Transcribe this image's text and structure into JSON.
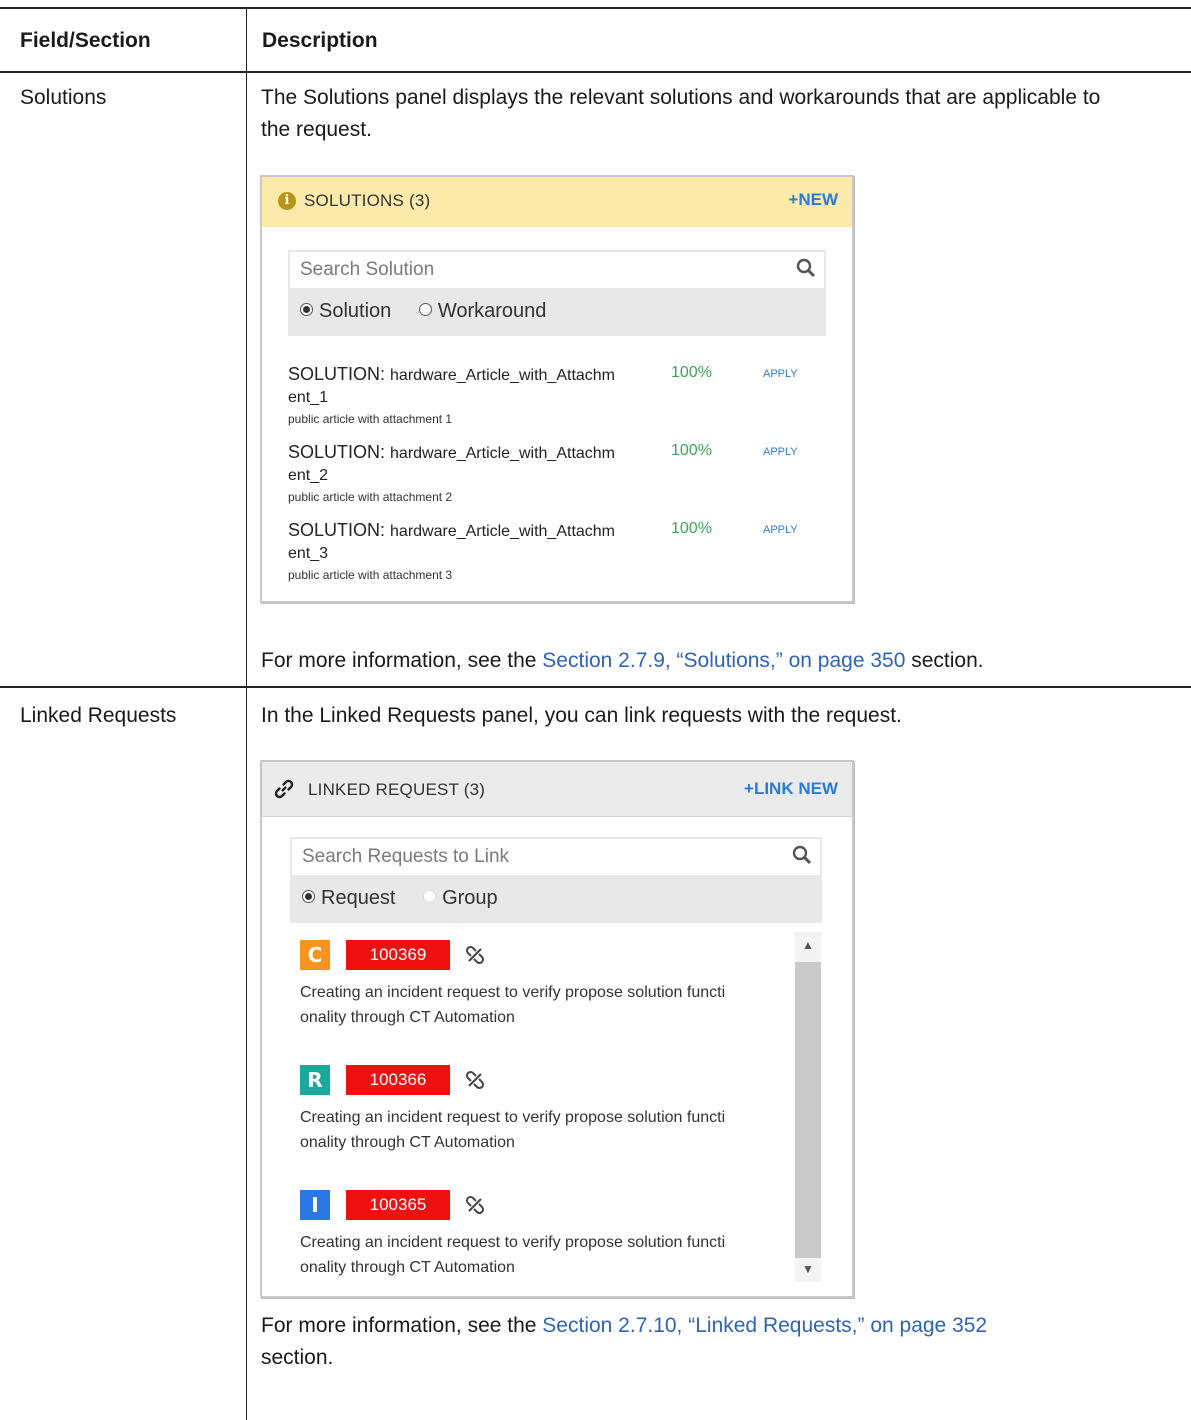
{
  "table": {
    "col1_header": "Field/Section",
    "col2_header": "Description"
  },
  "solutions_row": {
    "field": "Solutions",
    "description": "The Solutions panel displays the relevant solutions and workarounds that are applicable to the request.",
    "more_prefix": "For more information, see the ",
    "more_link": "Section 2.7.9, “Solutions,” on page 350",
    "more_suffix": " section.",
    "panel": {
      "title": "SOLUTIONS (3)",
      "action": "+NEW",
      "search_placeholder": "Search Solution",
      "radio_1": "Solution",
      "radio_2": "Workaround",
      "items": [
        {
          "prefix": "SOLUTION: ",
          "name": "hardware_Article_with_Attachm",
          "name_cont": "ent_1",
          "sub": "public article with attachment 1",
          "pct": "100%",
          "apply": "APPLY"
        },
        {
          "prefix": "SOLUTION: ",
          "name": "hardware_Article_with_Attachm",
          "name_cont": "ent_2",
          "sub": "public article with attachment 2",
          "pct": "100%",
          "apply": "APPLY"
        },
        {
          "prefix": "SOLUTION: ",
          "name": "hardware_Article_with_Attachm",
          "name_cont": "ent_3",
          "sub": "public article with attachment 3",
          "pct": "100%",
          "apply": "APPLY"
        }
      ]
    }
  },
  "linked_row": {
    "field": "Linked Requests",
    "description": "In the Linked Requests panel, you can link requests with the request.",
    "more_prefix": "For more information, see the ",
    "more_link": "Section 2.7.10, “Linked Requests,” on page 352",
    "more_suffix": "section.",
    "panel": {
      "title": "LINKED REQUEST (3)",
      "action": "+LINK NEW",
      "search_placeholder": "Search Requests to Link",
      "radio_1": "Request",
      "radio_2": "Group",
      "items": [
        {
          "type": "C",
          "color": "#f7941d",
          "id": "100369",
          "line1": "Creating an incident request to verify propose solution functi",
          "line2": "onality through CT Automation"
        },
        {
          "type": "R",
          "color": "#1aa99a",
          "id": "100366",
          "line1": "Creating an incident request to verify propose solution functi",
          "line2": "onality through CT Automation"
        },
        {
          "type": "I",
          "color": "#2b78e4",
          "id": "100365",
          "line1": "Creating an incident request to verify propose solution functi",
          "line2": "onality through CT Automation"
        }
      ]
    }
  }
}
